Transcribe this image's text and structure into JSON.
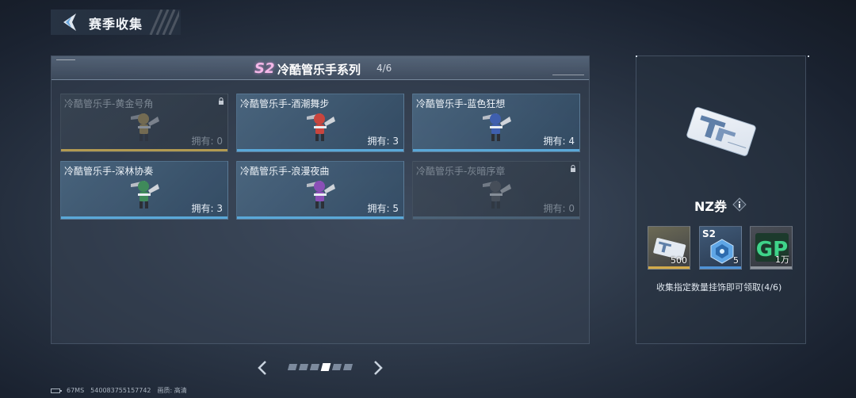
{
  "header": {
    "title": "赛季收集"
  },
  "series": {
    "season_badge": "S2",
    "title": "冷酷管乐手系列",
    "progress": "4/6"
  },
  "cards": [
    {
      "name": "冷酷管乐手-黄金号角",
      "owned": "拥有: 0",
      "locked": true,
      "color": "#c2a25a"
    },
    {
      "name": "冷酷管乐手-酒潮舞步",
      "owned": "拥有: 3",
      "locked": false,
      "color": "#c8453e"
    },
    {
      "name": "冷酷管乐手-蓝色狂想",
      "owned": "拥有: 4",
      "locked": false,
      "color": "#3f5fae"
    },
    {
      "name": "冷酷管乐手-深林协奏",
      "owned": "拥有: 3",
      "locked": false,
      "color": "#3f8a5a"
    },
    {
      "name": "冷酷管乐手-浪漫夜曲",
      "owned": "拥有: 5",
      "locked": false,
      "color": "#8a4fb6"
    },
    {
      "name": "冷酷管乐手-灰暗序章",
      "owned": "拥有: 0",
      "locked": true,
      "color": "#5a5e66"
    }
  ],
  "pager": {
    "total": 6,
    "active_index": 3
  },
  "reward": {
    "name": "NZ券",
    "items": [
      {
        "icon": "ticket-icon",
        "qty": "500"
      },
      {
        "icon": "crystal-icon",
        "tag": "S2",
        "qty": "5"
      },
      {
        "icon": "gp-icon",
        "label": "GP",
        "qty": "1万"
      }
    ],
    "description": "收集指定数量挂饰即可领取(4/6)"
  },
  "footer": {
    "ping": "67MS",
    "id": "540083755157742",
    "quality": "画质: 高清"
  }
}
